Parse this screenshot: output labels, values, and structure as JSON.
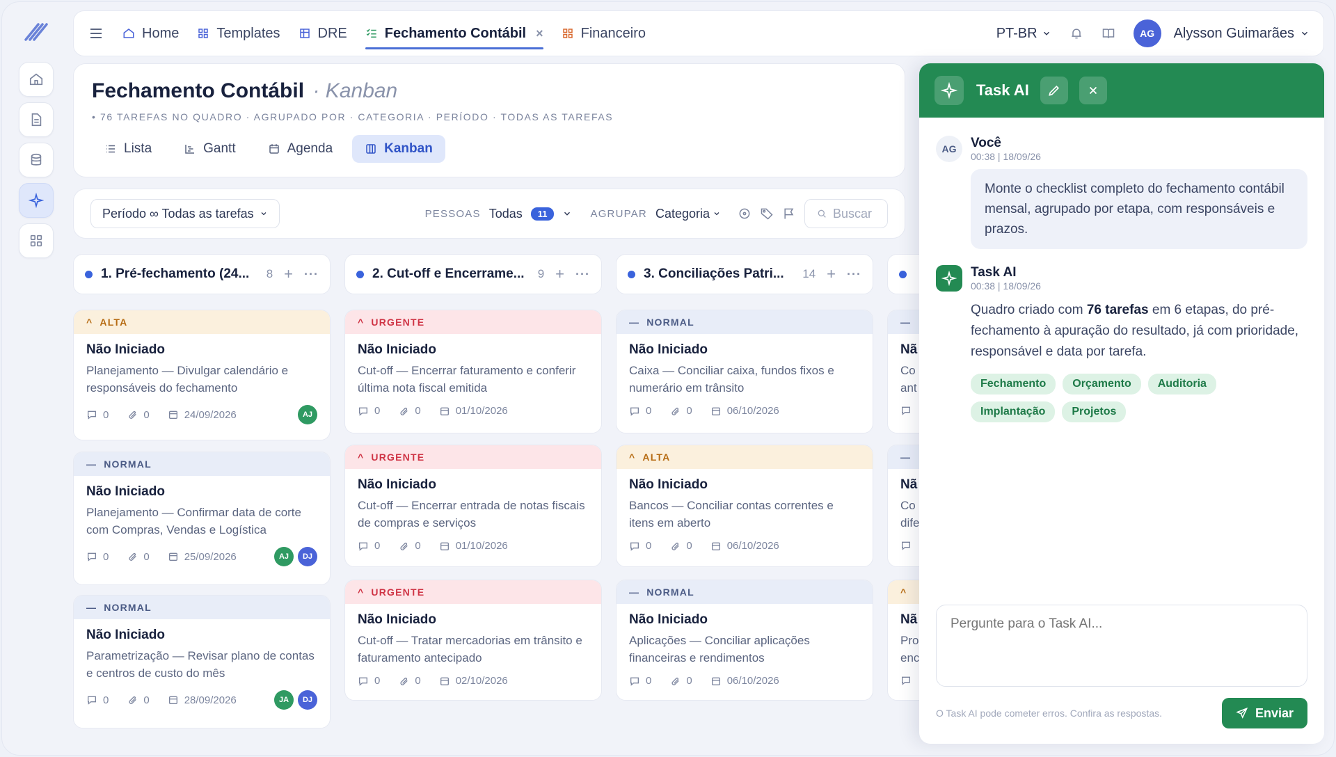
{
  "nav": {
    "tabs": [
      {
        "label": "Home",
        "icon": "home-icon"
      },
      {
        "label": "Templates",
        "icon": "grid-icon"
      },
      {
        "label": "DRE",
        "icon": "table-icon"
      },
      {
        "label": "Fechamento Contábil",
        "icon": "checklist-icon",
        "active": true
      },
      {
        "label": "Financeiro",
        "icon": "grid-icon"
      }
    ],
    "close_glyph": "×",
    "language": "PT-BR",
    "user_initials": "AG",
    "user_name": "Alysson Guimarães"
  },
  "header": {
    "title": "Fechamento Contábil",
    "subtitle": "· Kanban",
    "meta": "• 76 TAREFAS NO QUADRO · AGRUPADO POR · CATEGORIA · PERÍODO · TODAS AS TAREFAS",
    "views": [
      "Lista",
      "Gantt",
      "Agenda",
      "Kanban"
    ],
    "active_view": "Kanban"
  },
  "filters": {
    "period": "Período ∞ Todas as tarefas",
    "people_label": "PESSOAS",
    "people_value": "Todas",
    "people_count": "11",
    "group_label": "AGRUPAR",
    "group_value": "Categoria",
    "search_placeholder": "Buscar"
  },
  "board": {
    "columns": [
      {
        "title": "1. Pré-fechamento (24...",
        "count": "8",
        "cards": [
          {
            "priority": "ALTA",
            "status": "Não Iniciado",
            "desc": "Planejamento — Divulgar calendário e responsáveis do fechamento",
            "comments": "0",
            "attachments": "0",
            "date": "24/09/2026",
            "assignees": [
              "AJ"
            ]
          },
          {
            "priority": "NORMAL",
            "status": "Não Iniciado",
            "desc": "Planejamento — Confirmar data de corte com Compras, Vendas e Logística",
            "comments": "0",
            "attachments": "0",
            "date": "25/09/2026",
            "assignees": [
              "AJ",
              "DJ"
            ]
          },
          {
            "priority": "NORMAL",
            "status": "Não Iniciado",
            "desc": "Parametrização — Revisar plano de contas e centros de custo do mês",
            "comments": "0",
            "attachments": "0",
            "date": "28/09/2026",
            "assignees": [
              "JA",
              "DJ"
            ]
          }
        ]
      },
      {
        "title": "2. Cut-off e Encerrame...",
        "count": "9",
        "cards": [
          {
            "priority": "URGENTE",
            "status": "Não Iniciado",
            "desc": "Cut-off — Encerrar faturamento e conferir última nota fiscal emitida",
            "comments": "0",
            "attachments": "0",
            "date": "01/10/2026",
            "assignees": []
          },
          {
            "priority": "URGENTE",
            "status": "Não Iniciado",
            "desc": "Cut-off — Encerrar entrada de notas fiscais de compras e serviços",
            "comments": "0",
            "attachments": "0",
            "date": "01/10/2026",
            "assignees": []
          },
          {
            "priority": "URGENTE",
            "status": "Não Iniciado",
            "desc": "Cut-off — Tratar mercadorias em trânsito e faturamento antecipado",
            "comments": "0",
            "attachments": "0",
            "date": "02/10/2026",
            "assignees": []
          }
        ]
      },
      {
        "title": "3. Conciliações Patri...",
        "count": "14",
        "cards": [
          {
            "priority": "NORMAL",
            "status": "Não Iniciado",
            "desc": "Caixa — Conciliar caixa, fundos fixos e numerário em trânsito",
            "comments": "0",
            "attachments": "0",
            "date": "06/10/2026",
            "assignees": []
          },
          {
            "priority": "ALTA",
            "status": "Não Iniciado",
            "desc": "Bancos — Conciliar contas correntes e itens em aberto",
            "comments": "0",
            "attachments": "0",
            "date": "06/10/2026",
            "assignees": []
          },
          {
            "priority": "NORMAL",
            "status": "Não Iniciado",
            "desc": "Aplicações — Conciliar aplicações financeiras e rendimentos",
            "comments": "0",
            "attachments": "0",
            "date": "06/10/2026",
            "assignees": []
          }
        ]
      }
    ],
    "partial_column": {
      "priorities": [
        "—",
        "—",
        "^"
      ],
      "status_fragments": [
        "Nã",
        "Nã",
        "Nã"
      ],
      "desc_fragments": [
        [
          "Co",
          "ant"
        ],
        [
          "Co",
          "dife"
        ],
        [
          "Pro",
          "enc"
        ]
      ]
    }
  },
  "ai": {
    "title": "Task AI",
    "messages": [
      {
        "author": "Você",
        "initials": "AG",
        "time": "00:38 | 18/09/26",
        "text": "Monte o checklist completo do fechamento contábil mensal, agrupado por etapa, com responsáveis e prazos."
      },
      {
        "author": "Task AI",
        "time": "00:38 | 18/09/26",
        "text_before": "Quadro criado com ",
        "text_bold": "76 tarefas",
        "text_after": " em 6 etapas, do pré-fechamento à apuração do resultado, já com prioridade, responsável e data por tarefa."
      }
    ],
    "chips": [
      "Fechamento",
      "Orçamento",
      "Auditoria",
      "Implantação",
      "Projetos"
    ],
    "input_placeholder": "Pergunte para o Task AI...",
    "disclaimer": "O Task AI pode cometer erros. Confira as respostas.",
    "send_label": "Enviar"
  }
}
